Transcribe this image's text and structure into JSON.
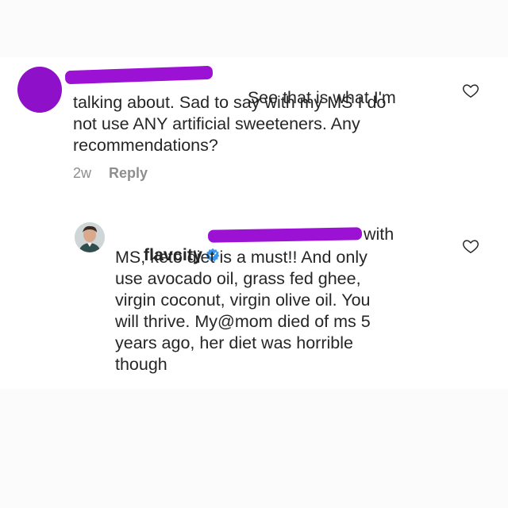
{
  "comment1": {
    "avatar": "redacted-avatar",
    "username": "",
    "line1_suffix": "See that is what I'm",
    "line2": "talking about. Sad to say with my MS I do",
    "line3": "not use ANY artificial sweeteners. Any",
    "line4": "recommendations?",
    "time": "2w",
    "reply_label": "Reply",
    "like_icon": "heart-outline-icon"
  },
  "comment2": {
    "avatar": "profile-photo",
    "username": "flavcity",
    "verified_icon": "verified-badge-icon",
    "line1_suffix": "with",
    "line2": "MS, keto diet is a must!! And only",
    "line3": "use avocado oil, grass fed ghee,",
    "line4": "virgin coconut, virgin olive oil. You",
    "line5": "will thrive. My@mom died of ms 5",
    "line6": "years ago, her diet was horrible",
    "line7": "though",
    "like_icon": "heart-outline-icon"
  },
  "colors": {
    "redaction": "#9b12d4",
    "text": "#262626",
    "meta": "#8e8e8e",
    "verified": "#3897f0"
  }
}
